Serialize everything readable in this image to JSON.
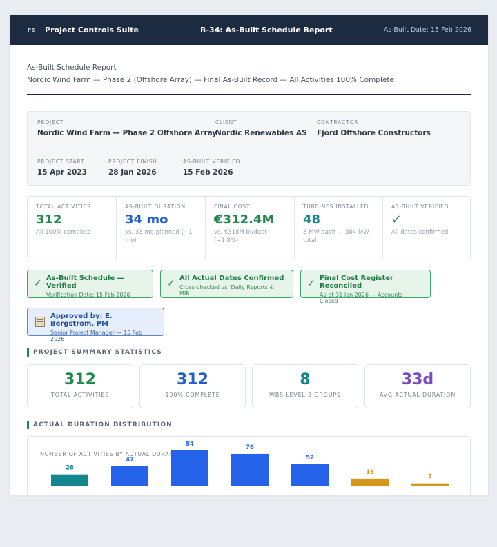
{
  "app": {
    "logo": "P6",
    "suite": "Project Controls Suite",
    "report_title": "R-34: As-Built Schedule Report",
    "header_date": "As-Built Date: 15 Feb 2026"
  },
  "heading": {
    "title": "As-Built Schedule Report",
    "subtitle": "Nordic Wind Farm — Phase 2 (Offshore Array) — Final As-Built Record — All Activities 100% Complete"
  },
  "info": {
    "project_label": "PROJECT",
    "project_value": "Nordic Wind Farm — Phase 2 Offshore Array",
    "client_label": "CLIENT",
    "client_value": "Nordic Renewables AS",
    "contractor_label": "CONTRACTOR",
    "contractor_value": "Fjord Offshore Constructors",
    "start_label": "PROJECT START",
    "start_value": "15 Apr 2023",
    "finish_label": "PROJECT FINISH",
    "finish_value": "28 Jan 2026",
    "verified_label": "AS-BUILT VERIFIED",
    "verified_value": "15 Feb 2026"
  },
  "kpis": [
    {
      "label": "TOTAL ACTIVITIES",
      "value": "312",
      "sub": "All 100% complete",
      "color": "#1f8a4c"
    },
    {
      "label": "AS-BUILT DURATION",
      "value": "34 mo",
      "sub": "vs. 33 mo planned (+1 mo)",
      "color": "#1f5fcc"
    },
    {
      "label": "FINAL COST",
      "value": "€312.4M",
      "sub": "vs. €318M budget (−1.8%)",
      "color": "#1f8a4c"
    },
    {
      "label": "TURBINES INSTALLED",
      "value": "48",
      "sub": "8 MW each — 384 MW total",
      "color": "#13868e"
    },
    {
      "label": "AS-BUILT VERIFIED",
      "value": "✓",
      "sub": "All dates confirmed",
      "color": "#1f8a4c"
    }
  ],
  "badges": [
    {
      "title": "As-Built Schedule — Verified",
      "sub": "Verification Date: 15 Feb 2026"
    },
    {
      "title": "All Actual Dates Confirmed",
      "sub": "Cross-checked vs. Daily Reports & MIR"
    },
    {
      "title": "Final Cost Register Reconciled",
      "sub": "As-at 31 Jan 2026 — Accounts Closed"
    },
    {
      "title": "Approved by: E. Bergstrom, PM",
      "sub": "Senior Project Manager — 15 Feb 2026"
    }
  ],
  "summary": {
    "title": "PROJECT SUMMARY STATISTICS",
    "stats": [
      {
        "value": "312",
        "label": "TOTAL ACTIVITIES",
        "color": "#1f8a4c"
      },
      {
        "value": "312",
        "label": "100% COMPLETE",
        "color": "#1f5fcc"
      },
      {
        "value": "8",
        "label": "WBS LEVEL 2 GROUPS",
        "color": "#13868e"
      },
      {
        "value": "33d",
        "label": "AVG ACTUAL DURATION",
        "color": "#7a4cc2"
      }
    ]
  },
  "distribution": {
    "title": "ACTUAL DURATION DISTRIBUTION"
  },
  "chart_data": {
    "type": "bar",
    "title": "NUMBER OF ACTIVITIES BY ACTUAL DURATION RANGE",
    "values": [
      28,
      47,
      84,
      76,
      52,
      18,
      7
    ],
    "colors": [
      "#13868e",
      "#2563eb",
      "#2563eb",
      "#2563eb",
      "#2563eb",
      "#d4961c",
      "#d4961c"
    ]
  }
}
